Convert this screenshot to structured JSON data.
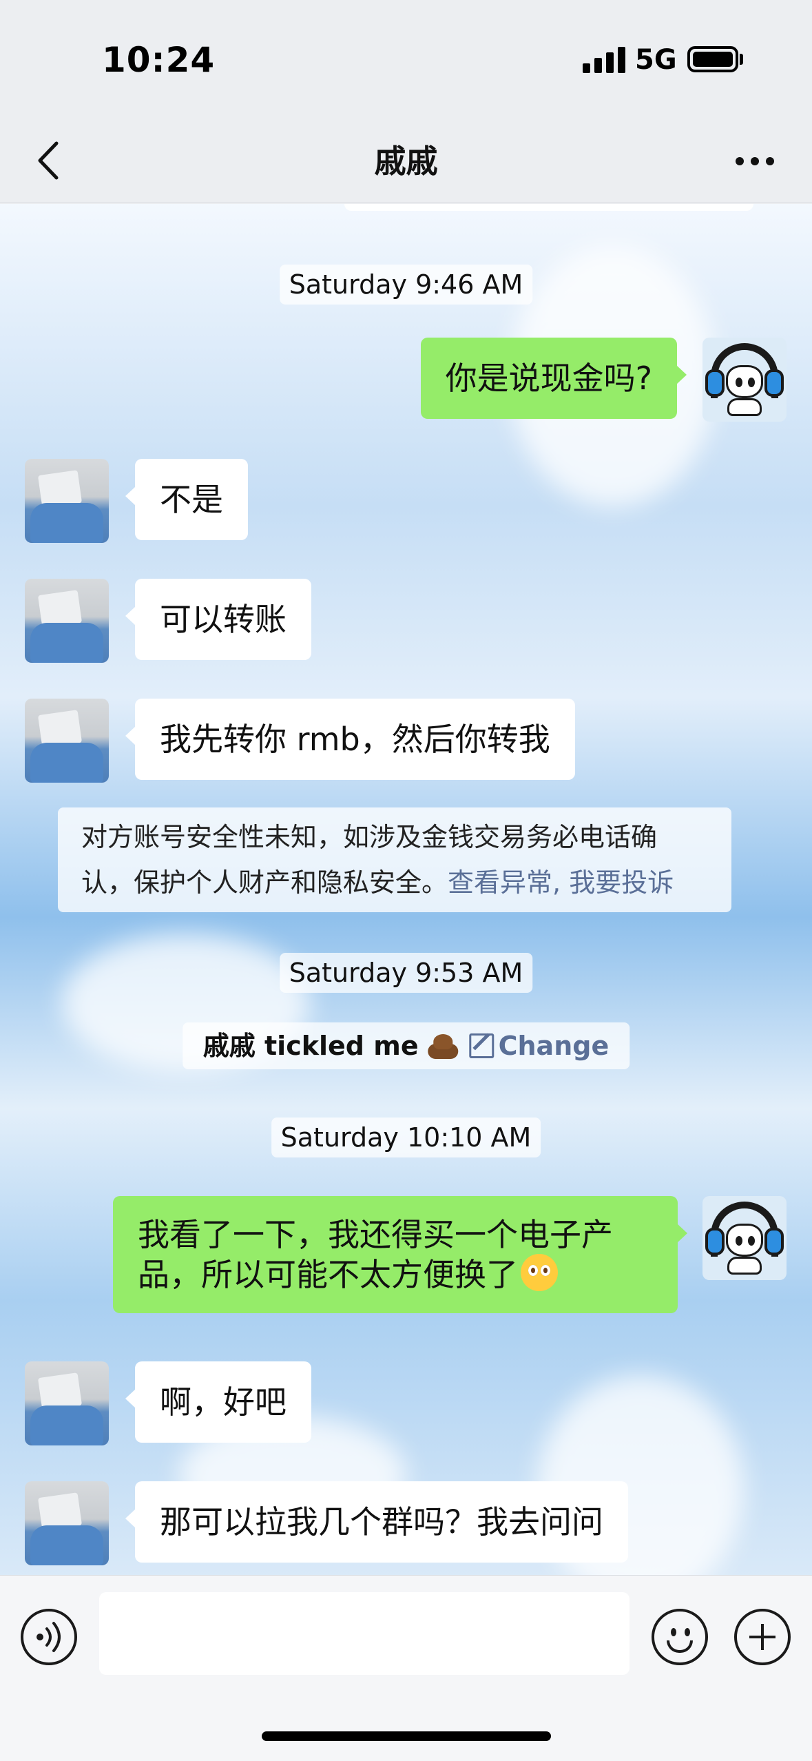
{
  "status_bar": {
    "time": "10:24",
    "network": "5G",
    "icons": [
      "signal-icon",
      "battery-icon"
    ]
  },
  "header": {
    "title": "戚戚",
    "back_icon": "chevron-left-icon",
    "more_icon": "more-dots-icon"
  },
  "chat": {
    "timestamps": [
      "Saturday 9:46 AM",
      "Saturday 9:53 AM",
      "Saturday 10:10 AM"
    ],
    "messages": [
      {
        "sender": "me",
        "text": "你是说现金吗?"
      },
      {
        "sender": "other",
        "text": "不是"
      },
      {
        "sender": "other",
        "text": "可以转账"
      },
      {
        "sender": "other",
        "text": "我先转你 rmb，然后你转我"
      },
      {
        "sender": "me",
        "text": "我看了一下，我还得买一个电子产品，所以可能不太方便换了",
        "emoji": "pleading-face-emoji"
      },
      {
        "sender": "other",
        "text": "啊，好吧"
      },
      {
        "sender": "other",
        "text": "那可以拉我几个群吗？我去问问"
      }
    ],
    "security_notice": {
      "text": "对方账号安全性未知，如涉及金钱交易务必电话确认，保护个人财产和隐私安全。",
      "link_view": "查看异常",
      "separator": ",",
      "link_report": "我要投诉"
    },
    "tickle_notice": {
      "text": "戚戚 tickled me",
      "emoji": "poop-emoji",
      "edit_icon": "edit-icon",
      "change_label": "Change"
    }
  },
  "input_bar": {
    "voice_icon": "voice-icon",
    "input_value": "",
    "emoji_icon": "smiley-icon",
    "add_icon": "plus-circle-icon"
  },
  "colors": {
    "my_bubble": "#95ec69",
    "other_bubble": "#ffffff",
    "link": "#5a6f97"
  }
}
